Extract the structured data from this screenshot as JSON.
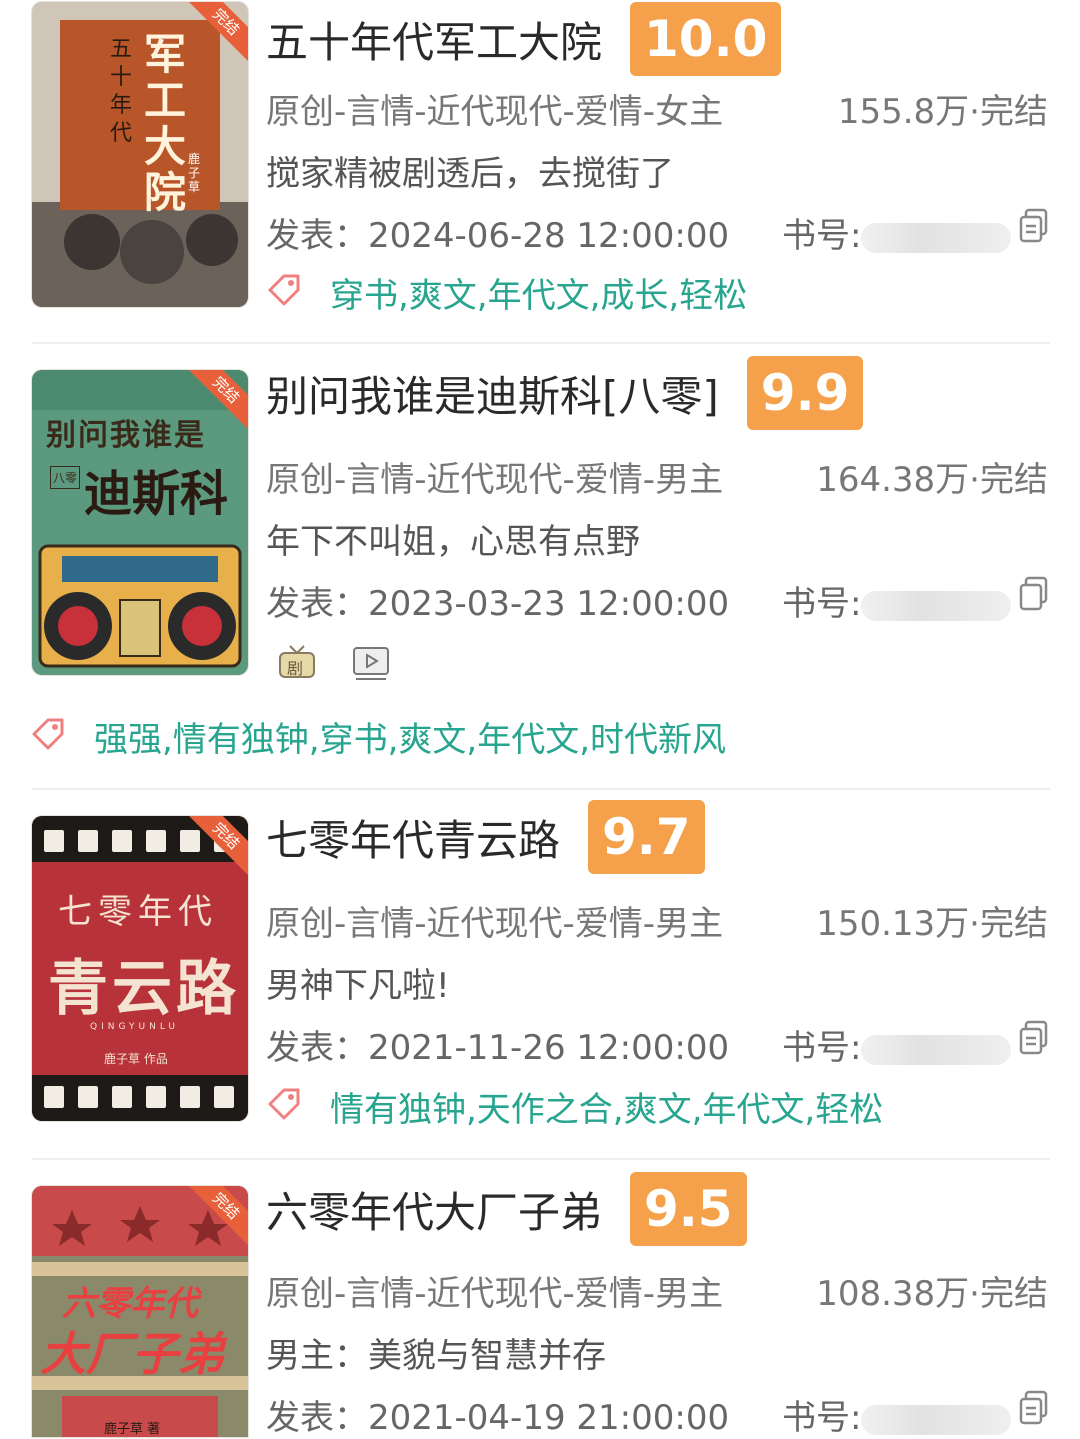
{
  "books": [
    {
      "title": "五十年代军工大院",
      "score": "10.0",
      "category": "原创-言情-近代现代-爱情-女主",
      "stats": "155.8万·完结",
      "summary": "搅家精被剧透后，去搅街了",
      "published": "发表：2024-06-28 12:00:00",
      "book_no_label": "书号:",
      "tags": "穿书,爽文,年代文,成长,轻松",
      "cover": {
        "line1": "五十年代",
        "line2": "军工大院",
        "author": "鹿子草",
        "corner": "完结"
      }
    },
    {
      "title": "别问我谁是迪斯科[八零]",
      "score": "9.9",
      "category": "原创-言情-近代现代-爱情-男主",
      "stats": "164.38万·完结",
      "summary": "年下不叫姐，心思有点野",
      "published": "发表：2023-03-23 12:00:00",
      "book_no_label": "书号:",
      "tags": "强强,情有独钟,穿书,爽文,年代文,时代新风",
      "media": {
        "drama_icon_label": "剧"
      },
      "cover": {
        "line1": "别问我谁是",
        "line2": "迪斯科",
        "tag": "八零",
        "corner": "完结"
      }
    },
    {
      "title": "七零年代青云路",
      "score": "9.7",
      "category": "原创-言情-近代现代-爱情-男主",
      "stats": "150.13万·完结",
      "summary": "男神下凡啦!",
      "published": "发表：2021-11-26 12:00:00",
      "book_no_label": "书号:",
      "tags": "情有独钟,天作之合,爽文,年代文,轻松",
      "cover": {
        "line1": "七零年代",
        "line2": "青云路",
        "pinyin": "QINGYUNLU",
        "author": "鹿子草 作品",
        "corner": "完结"
      }
    },
    {
      "title": "六零年代大厂子弟",
      "score": "9.5",
      "category": "原创-言情-近代现代-爱情-男主",
      "stats": "108.38万·完结",
      "summary": "男主：美貌与智慧并存",
      "published": "发表：2021-04-19 21:00:00",
      "book_no_label": "书号:",
      "cover": {
        "line1": "六零年代",
        "line2": "大厂子弟",
        "author": "鹿子草 著",
        "corner": "完结"
      }
    }
  ],
  "colors": {
    "score_bg": "#f5a04a",
    "tag_text": "#27a58f",
    "tag_icon": "#f08080",
    "corner_badge": "#e8603a"
  },
  "icons": {
    "tag": "tag-icon",
    "copy": "copy-icon",
    "drama": "tv-drama-icon",
    "video": "video-play-icon"
  }
}
